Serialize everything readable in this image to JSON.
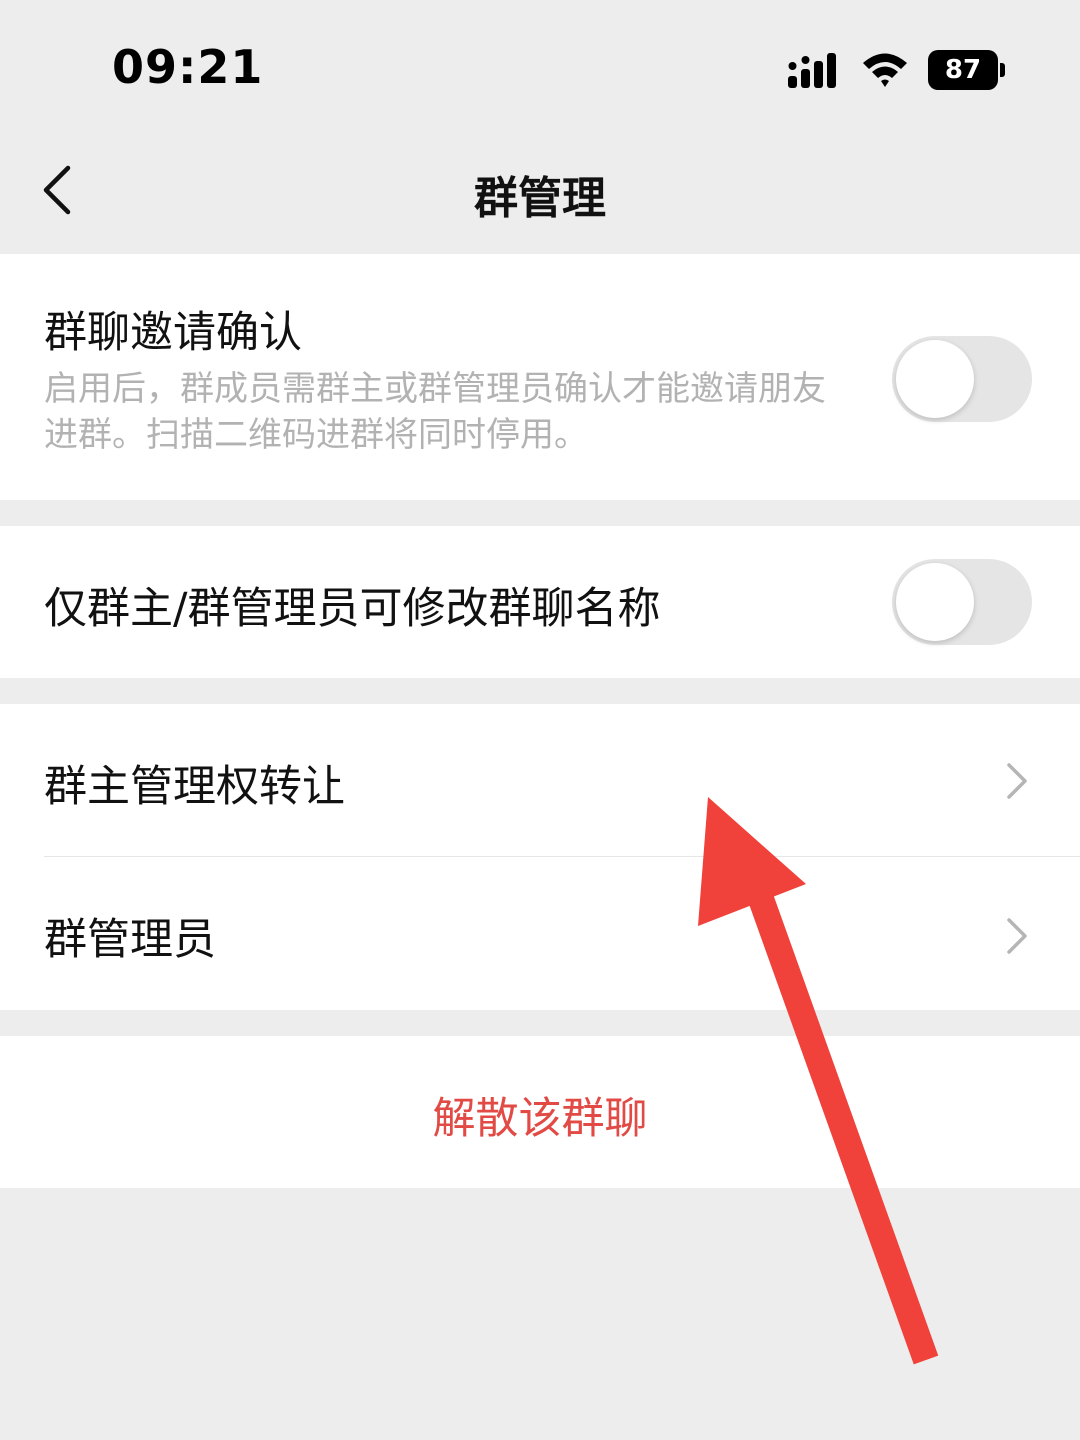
{
  "status_bar": {
    "time": "09:21",
    "battery": "87",
    "signal_icon": "cellular-signal-icon",
    "wifi_icon": "wifi-icon"
  },
  "nav": {
    "title": "群管理",
    "back_icon": "chevron-left-icon"
  },
  "settings": {
    "invite_confirm": {
      "title": "群聊邀请确认",
      "description": "启用后，群成员需群主或群管理员确认才能邀请朋友进群。扫描二维码进群将同时停用。",
      "enabled": false
    },
    "rename_restriction": {
      "title": "仅群主/群管理员可修改群聊名称",
      "enabled": false
    },
    "transfer_owner": {
      "label": "群主管理权转让"
    },
    "admins": {
      "label": "群管理员"
    }
  },
  "danger": {
    "dissolve_label": "解散该群聊"
  },
  "colors": {
    "background": "#ededed",
    "danger": "#e24a45",
    "annotation_arrow": "#f0413a",
    "toggle_off": "#e5e5e5"
  }
}
